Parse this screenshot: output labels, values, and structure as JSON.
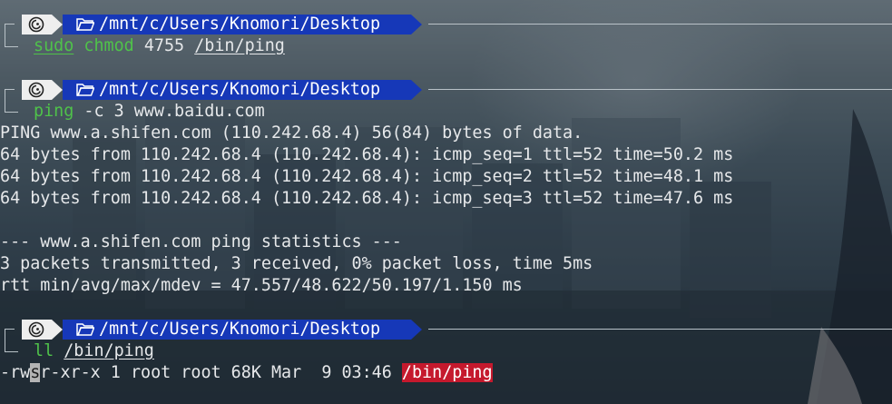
{
  "prompt": {
    "os_icon": "debian-swirl-icon",
    "folder_icon": "folder-open-icon",
    "path": "/mnt/c/Users/Knomori/Desktop"
  },
  "blocks": [
    {
      "command": {
        "parts": [
          "sudo",
          "chmod",
          "4755",
          "/bin/ping"
        ]
      }
    },
    {
      "command": {
        "parts": [
          "ping",
          "-c 3 www.baidu.com"
        ]
      },
      "output": [
        "PING www.a.shifen.com (110.242.68.4) 56(84) bytes of data.",
        "64 bytes from 110.242.68.4 (110.242.68.4): icmp_seq=1 ttl=52 time=50.2 ms",
        "64 bytes from 110.242.68.4 (110.242.68.4): icmp_seq=2 ttl=52 time=48.1 ms",
        "64 bytes from 110.242.68.4 (110.242.68.4): icmp_seq=3 ttl=52 time=47.6 ms",
        "",
        "--- www.a.shifen.com ping statistics ---",
        "3 packets transmitted, 3 received, 0% packet loss, time 5ms",
        "rtt min/avg/max/mdev = 47.557/48.622/50.197/1.150 ms"
      ]
    },
    {
      "command": {
        "parts": [
          "ll",
          "/bin/ping"
        ]
      },
      "listing": {
        "perm_a": "-rw",
        "perm_cursor": "s",
        "perm_b": "r-xr-x",
        "rest": " 1 root root 68K Mar  9 03:46 ",
        "filename": "/bin/ping"
      }
    }
  ],
  "colors": {
    "command_ok": "#4fc24a",
    "path_bg": "#1638b8",
    "os_bg": "#eeeeee",
    "setuid_highlight": "#c5192d",
    "text": "#e6e8ea"
  }
}
